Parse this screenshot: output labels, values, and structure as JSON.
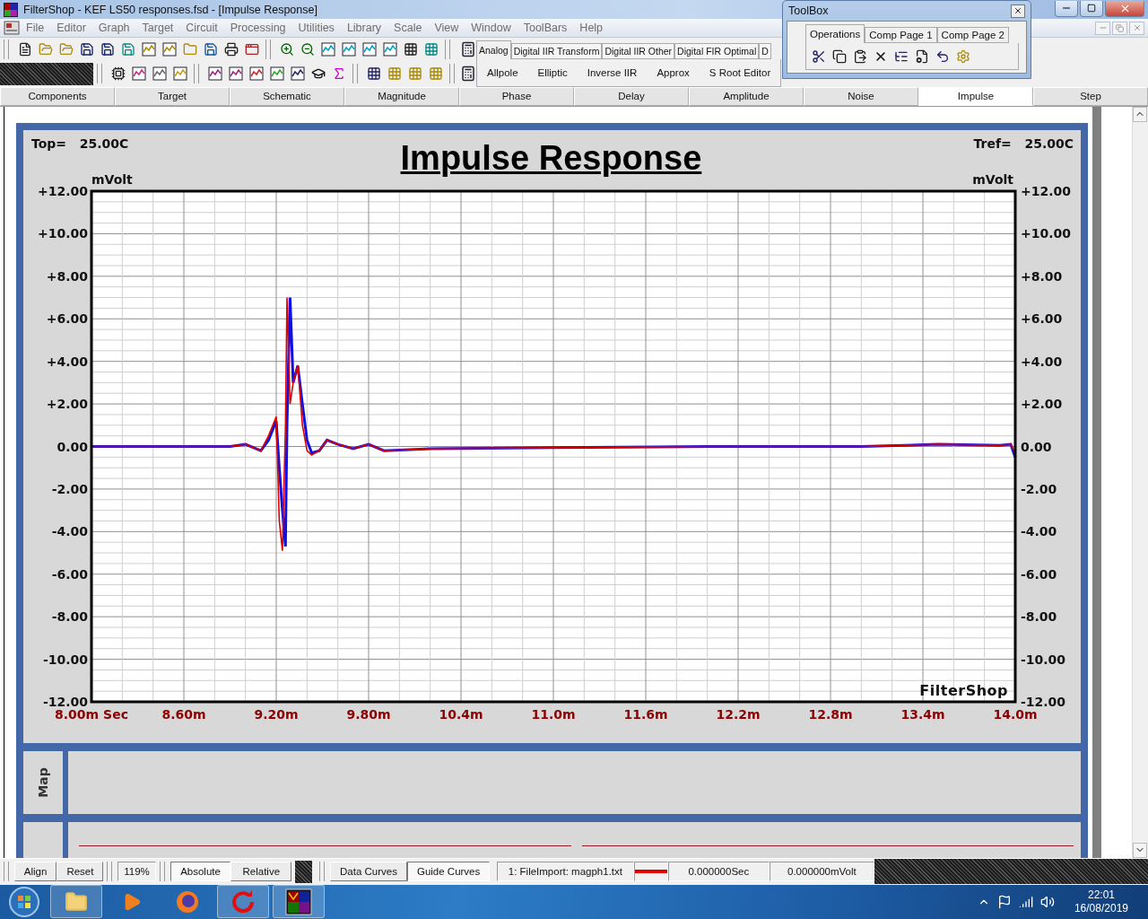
{
  "window": {
    "title": "FilterShop - KEF LS50 responses.fsd - [Impulse Response]"
  },
  "menu": [
    "File",
    "Editor",
    "Graph",
    "Target",
    "Circuit",
    "Processing",
    "Utilities",
    "Library",
    "Scale",
    "View",
    "Window",
    "ToolBars",
    "Help"
  ],
  "design_tabs": [
    {
      "label": "Analog",
      "selected": true
    },
    {
      "label": "Digital IIR Transform",
      "selected": false
    },
    {
      "label": "Digital IIR Other",
      "selected": false
    },
    {
      "label": "Digital FIR Optimal",
      "selected": false
    },
    {
      "label": "D",
      "selected": false
    }
  ],
  "design_buttons": [
    "Allpole",
    "Elliptic",
    "Inverse IIR",
    "Approx",
    "S Root Editor"
  ],
  "toolbox": {
    "title": "ToolBox",
    "tabs": [
      {
        "label": "Operations",
        "selected": true
      },
      {
        "label": "Comp Page 1",
        "selected": false
      },
      {
        "label": "Comp Page 2",
        "selected": false
      }
    ]
  },
  "view_tabs": [
    {
      "label": "Components",
      "selected": false
    },
    {
      "label": "Target",
      "selected": false
    },
    {
      "label": "Schematic",
      "selected": false
    },
    {
      "label": "Magnitude",
      "selected": false
    },
    {
      "label": "Phase",
      "selected": false
    },
    {
      "label": "Delay",
      "selected": false
    },
    {
      "label": "Amplitude",
      "selected": false
    },
    {
      "label": "Noise",
      "selected": false
    },
    {
      "label": "Impulse",
      "selected": true
    },
    {
      "label": "Step",
      "selected": false
    }
  ],
  "graph": {
    "title": "Impulse Response",
    "top_label": "Top=",
    "top_value": "25.00C",
    "tref_label": "Tref=",
    "tref_value": "25.00C",
    "right_unit": "mVolt",
    "brand": "FilterShop",
    "right_axis_labels": [
      "+12.00",
      "+10.00",
      "+8.00",
      "+6.00",
      "+4.00",
      "+2.00",
      "0.00",
      "-2.00",
      "-4.00",
      "-6.00",
      "-8.00",
      "-10.00",
      "-12.00"
    ],
    "chart_data": {
      "type": "line",
      "ylabel": "mVolt",
      "grid": true,
      "xlim": [
        8.0,
        14.0
      ],
      "ylim": [
        -12,
        12
      ],
      "x": [
        8.0,
        8.9,
        9.0,
        9.1,
        9.15,
        9.2,
        9.22,
        9.24,
        9.26,
        9.27,
        9.29,
        9.31,
        9.34,
        9.37,
        9.4,
        9.43,
        9.48,
        9.53,
        9.6,
        9.7,
        9.8,
        9.9,
        10.2,
        11.0,
        12.0,
        13.0,
        13.5,
        13.9,
        13.97,
        14.0
      ],
      "series": [
        {
          "color": "#e00000",
          "values": [
            0,
            0,
            0.1,
            -0.2,
            0.5,
            1.4,
            -3.5,
            -4.9,
            1,
            7,
            2,
            3,
            3.8,
            1,
            -0.2,
            -0.4,
            -0.2,
            0.3,
            0.1,
            -0.1,
            0.1,
            -0.2,
            -0.1,
            -0.05,
            0,
            0,
            0.1,
            0.05,
            0.1,
            -0.3
          ]
        },
        {
          "color": "#1010e0",
          "values": [
            0,
            0,
            0.1,
            -0.2,
            0.3,
            1.2,
            -1,
            -3,
            -4.7,
            1,
            7,
            3,
            3.8,
            2,
            0.3,
            -0.3,
            -0.2,
            0.3,
            0.1,
            -0.1,
            0.1,
            -0.2,
            -0.1,
            -0.05,
            0,
            0,
            0.1,
            0.05,
            0.1,
            -0.5
          ]
        }
      ],
      "xticks": [
        {
          "value": 8.0,
          "label": "8.00m Sec"
        },
        {
          "value": 8.6,
          "label": "8.60m"
        },
        {
          "value": 9.2,
          "label": "9.20m"
        },
        {
          "value": 9.8,
          "label": "9.80m"
        },
        {
          "value": 10.4,
          "label": "10.4m"
        },
        {
          "value": 11.0,
          "label": "11.0m"
        },
        {
          "value": 11.6,
          "label": "11.6m"
        },
        {
          "value": 12.2,
          "label": "12.2m"
        },
        {
          "value": 12.8,
          "label": "12.8m"
        },
        {
          "value": 13.4,
          "label": "13.4m"
        },
        {
          "value": 14.0,
          "label": "14.0m"
        }
      ],
      "yticks": [
        {
          "value": 12,
          "label": "+12.00"
        },
        {
          "value": 10,
          "label": "+10.00"
        },
        {
          "value": 8,
          "label": "+8.00"
        },
        {
          "value": 6,
          "label": "+6.00"
        },
        {
          "value": 4,
          "label": "+4.00"
        },
        {
          "value": 2,
          "label": "+2.00"
        },
        {
          "value": 0,
          "label": "0.00"
        },
        {
          "value": -2,
          "label": "-2.00"
        },
        {
          "value": -4,
          "label": "-4.00"
        },
        {
          "value": -6,
          "label": "-6.00"
        },
        {
          "value": -8,
          "label": "-8.00"
        },
        {
          "value": -10,
          "label": "-10.00"
        },
        {
          "value": -12,
          "label": "-12.00"
        }
      ]
    }
  },
  "map_panel": {
    "label": "Map"
  },
  "status_bar": {
    "align": "Align",
    "reset": "Reset",
    "zoom": "119%",
    "modes": [
      {
        "label": "Absolute",
        "selected": true
      },
      {
        "label": "Relative",
        "selected": false
      }
    ],
    "curves": [
      {
        "label": "Data Curves",
        "selected": false
      },
      {
        "label": "Guide Curves",
        "selected": true
      }
    ],
    "curve": {
      "label": "1: FileImport: magph1.txt",
      "color": "#e00000"
    },
    "time": "0.000000Sec",
    "value": "0.000000mVolt"
  },
  "taskbar": {
    "time": "22:01",
    "date": "16/08/2019"
  }
}
